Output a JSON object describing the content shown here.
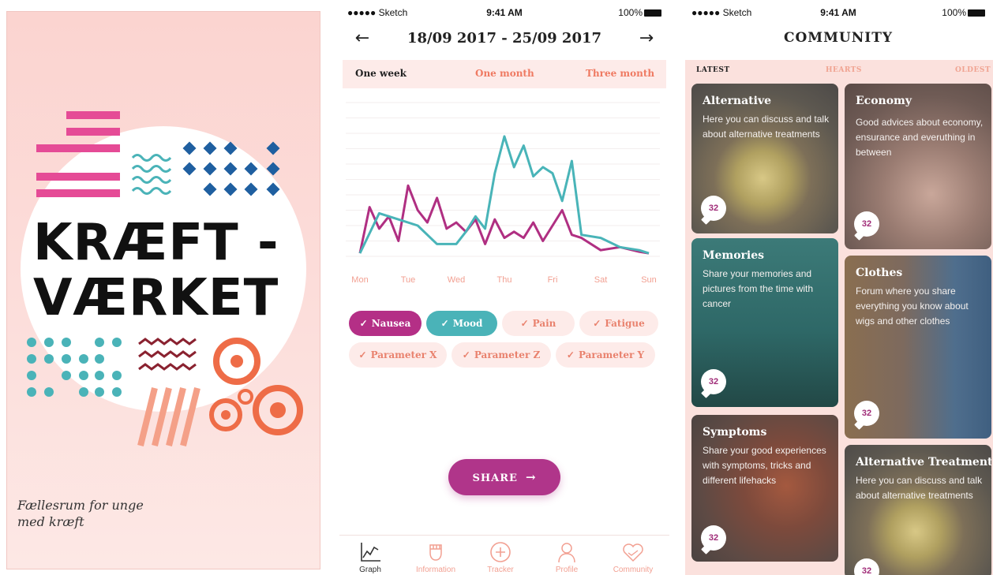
{
  "splash": {
    "logo_line1": "KRÆFT -",
    "logo_line2": "VÆRKET",
    "tagline": "Fællesrum for unge med kræft"
  },
  "graph_screen": {
    "status": {
      "carrier": "●●●●● Sketch",
      "time": "9:41 AM",
      "battery": "100%"
    },
    "date_range": "18/09 2017 - 25/09 2017",
    "back_icon": "arrow-left-icon",
    "forward_icon": "arrow-right-icon",
    "range_tabs": [
      "One week",
      "One month",
      "Three month"
    ],
    "active_range": "One week",
    "chart_data": {
      "type": "line",
      "categories": [
        "Mon",
        "Tue",
        "Wed",
        "Thu",
        "Fri",
        "Sat",
        "Sun"
      ],
      "ylim": [
        0,
        10
      ],
      "grid": true,
      "series": [
        {
          "name": "Nausea",
          "color": "#b02f82",
          "x": [
            0,
            0.2,
            0.4,
            0.6,
            0.8,
            1.0,
            1.2,
            1.4,
            1.6,
            1.8,
            2.0,
            2.2,
            2.4,
            2.6,
            2.8,
            3.0,
            3.2,
            3.4,
            3.6,
            3.8,
            4.0,
            4.2,
            4.4,
            4.6,
            5.0,
            5.4,
            5.8,
            6.0
          ],
          "values": [
            0.2,
            3.2,
            1.8,
            2.6,
            1.0,
            4.6,
            3.0,
            2.2,
            3.8,
            1.8,
            2.2,
            1.6,
            2.4,
            0.8,
            2.4,
            1.2,
            1.6,
            1.2,
            2.2,
            1.0,
            2.0,
            3.0,
            1.4,
            1.2,
            0.4,
            0.6,
            0.3,
            0.2
          ]
        },
        {
          "name": "Mood",
          "color": "#49b4b8",
          "x": [
            0,
            0.4,
            0.8,
            1.2,
            1.6,
            2.0,
            2.2,
            2.4,
            2.6,
            2.8,
            3.0,
            3.2,
            3.4,
            3.6,
            3.8,
            4.0,
            4.2,
            4.4,
            4.6,
            5.0,
            5.4,
            5.8,
            6.0
          ],
          "values": [
            0.2,
            2.8,
            2.4,
            2.0,
            0.8,
            0.8,
            1.6,
            2.6,
            1.8,
            5.4,
            7.8,
            5.8,
            7.2,
            5.2,
            5.8,
            5.4,
            3.6,
            6.2,
            1.4,
            1.2,
            0.6,
            0.4,
            0.2
          ]
        }
      ]
    },
    "chips": [
      {
        "label": "Nausea",
        "state": "on-purple"
      },
      {
        "label": "Mood",
        "state": "on-teal"
      },
      {
        "label": "Pain",
        "state": "off"
      },
      {
        "label": "Fatigue",
        "state": "off"
      },
      {
        "label": "Parameter X",
        "state": "off"
      },
      {
        "label": "Parameter Z",
        "state": "off"
      },
      {
        "label": "Parameter Y",
        "state": "off"
      }
    ],
    "check_glyph": "✓",
    "share_label": "SHARE",
    "share_arrow": "→",
    "tabs": [
      {
        "label": "Graph",
        "icon": "line-chart-icon",
        "active": true
      },
      {
        "label": "Information",
        "icon": "fist-icon",
        "active": false
      },
      {
        "label": "Tracker",
        "icon": "plus-circle-icon",
        "active": false
      },
      {
        "label": "Profile",
        "icon": "person-icon",
        "active": false
      },
      {
        "label": "Community",
        "icon": "heart-hands-icon",
        "active": false
      }
    ],
    "colors": {
      "accent": "#b0358a",
      "teal": "#4ab3b8",
      "salmon": "#ef7a62",
      "pale": "#fdebe9"
    }
  },
  "community_screen": {
    "status": {
      "carrier": "●●●●● Sketch",
      "time": "9:41 AM",
      "battery": "100%"
    },
    "title": "COMMUNITY",
    "sort_tabs": [
      "LATEST",
      "HEARTS",
      "OLDEST"
    ],
    "cards": [
      {
        "title": "Alternative",
        "desc": "Here you can discuss and talk about alternative treatments",
        "count": "32",
        "image": "lemon-tea-photo"
      },
      {
        "title": "Economy",
        "desc": "Good advices about economy, ensurance and everuthing in between",
        "count": "32",
        "image": "jewelry-photo"
      },
      {
        "title": "Memories",
        "desc": "Share your memories and pictures from the time with cancer",
        "count": "32",
        "image": "feet-over-water-photo"
      },
      {
        "title": "Clothes",
        "desc": "Forum where you share everything you know about wigs and other clothes",
        "count": "32",
        "image": "clothes-rack-photo"
      },
      {
        "title": "Symptoms",
        "desc": "Share your good experiences with symptoms, tricks and different lifehacks",
        "count": "32",
        "image": "woman-hair-photo"
      },
      {
        "title": "Alternative Treatment",
        "desc": "Here you can discuss and talk about alternative treatments",
        "count": "32",
        "image": "lemon-tea-photo"
      }
    ]
  }
}
